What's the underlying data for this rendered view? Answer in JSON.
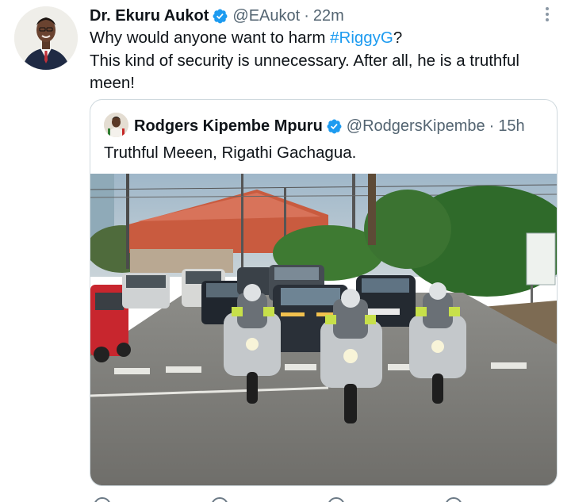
{
  "tweet": {
    "author_name": "Dr. Ekuru Aukot",
    "handle": "@EAukot",
    "separator": "·",
    "time": "22m",
    "text_prefix": "Why would anyone want to harm ",
    "hashtag": "#RiggyG",
    "text_suffix": "?",
    "text_line2": "This kind of security is unnecessary. After all, he is a truthful meen!"
  },
  "quote": {
    "author_name": "Rodgers Kipembe Mpuru",
    "handle": "@RodgersKipembe",
    "separator": "·",
    "time": "15h",
    "text": "Truthful Meeen, Rigathi Gachagua."
  },
  "actions": {
    "reply_count": "",
    "retweet_count": "",
    "like_count": "",
    "share_count": ""
  },
  "colors": {
    "verified": "#1d9bf0",
    "hashtag": "#1d9bf0",
    "secondary_text": "#536471"
  }
}
